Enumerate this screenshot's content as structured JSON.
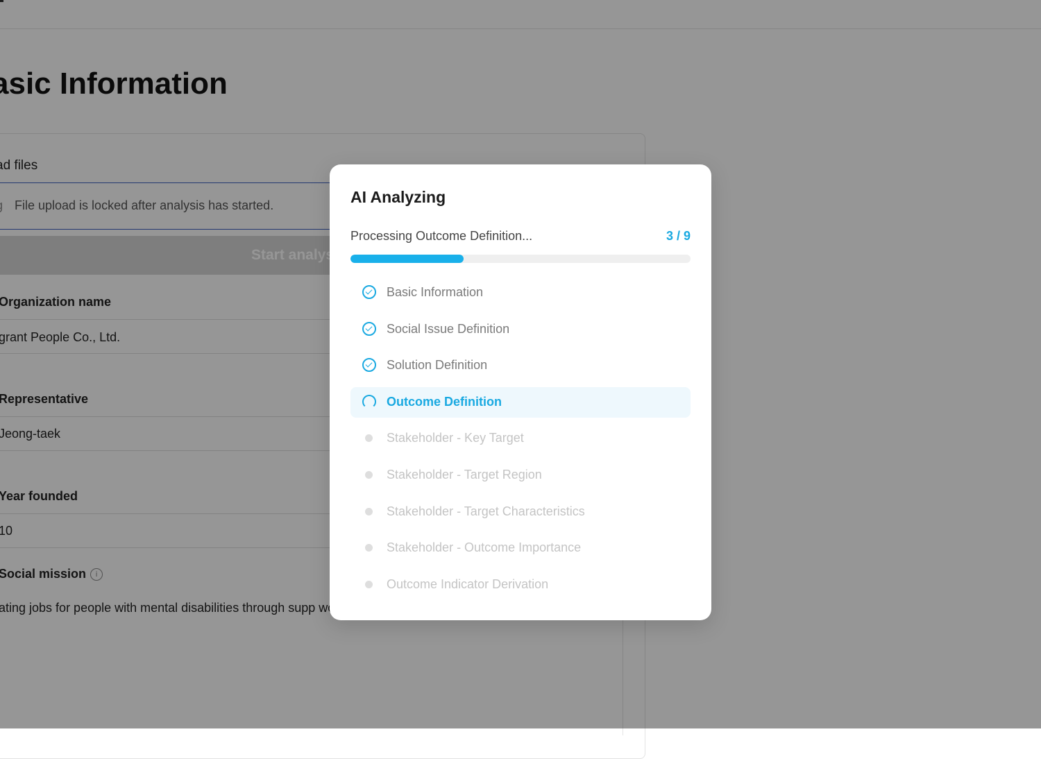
{
  "page": {
    "title": "asic Information",
    "upload_label": "ad files",
    "upload_note": "File upload is locked after analysis has started.",
    "start_button": "Start analys",
    "fields": [
      {
        "label": "Organization name",
        "value": "grant People Co., Ltd."
      },
      {
        "label": "Representative",
        "value": " Jeong-taek"
      },
      {
        "label": "Year founded",
        "value": "10"
      }
    ],
    "social_mission_label": "Social mission",
    "social_mission_text": "ating jobs for people with mental disabilities through supp work happily together."
  },
  "modal": {
    "title": "AI Analyzing",
    "processing_text": "Processing Outcome Definition...",
    "count": "3 / 9",
    "progress_fraction": 0.333,
    "accent_color": "#19a9e1",
    "steps": [
      {
        "label": "Basic Information",
        "status": "done",
        "icon": "check-circle-icon"
      },
      {
        "label": "Social Issue Definition",
        "status": "done",
        "icon": "check-circle-icon"
      },
      {
        "label": "Solution Definition",
        "status": "done",
        "icon": "check-circle-icon"
      },
      {
        "label": "Outcome Definition",
        "status": "current",
        "icon": "spinner-icon"
      },
      {
        "label": "Stakeholder - Key Target",
        "status": "pending",
        "icon": "dot-icon"
      },
      {
        "label": "Stakeholder - Target Region",
        "status": "pending",
        "icon": "dot-icon"
      },
      {
        "label": "Stakeholder - Target Characteristics",
        "status": "pending",
        "icon": "dot-icon"
      },
      {
        "label": "Stakeholder - Outcome Importance",
        "status": "pending",
        "icon": "dot-icon"
      },
      {
        "label": "Outcome Indicator Derivation",
        "status": "pending",
        "icon": "dot-icon"
      }
    ]
  }
}
